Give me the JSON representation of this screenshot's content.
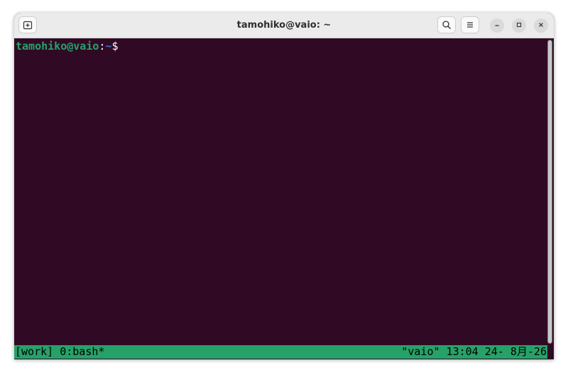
{
  "window": {
    "title": "tamohiko@vaio: ~"
  },
  "icons": {
    "new_tab": "new-tab-icon",
    "search": "search-icon",
    "menu": "hamburger-menu-icon",
    "minimize": "minimize-icon",
    "maximize": "maximize-icon",
    "close": "close-icon"
  },
  "terminal": {
    "prompt_user_host": "tamohiko@vaio",
    "prompt_colon": ":",
    "prompt_path": "~",
    "prompt_symbol": "$",
    "colors": {
      "background": "#300a24",
      "user_host": "#26a269",
      "path": "#4a6fc6",
      "text": "#ffffff"
    }
  },
  "tmux_status": {
    "left": "[work] 0:bash*",
    "right": "\"vaio\" 13:04 24- 8月-26",
    "background": "#26a269"
  }
}
